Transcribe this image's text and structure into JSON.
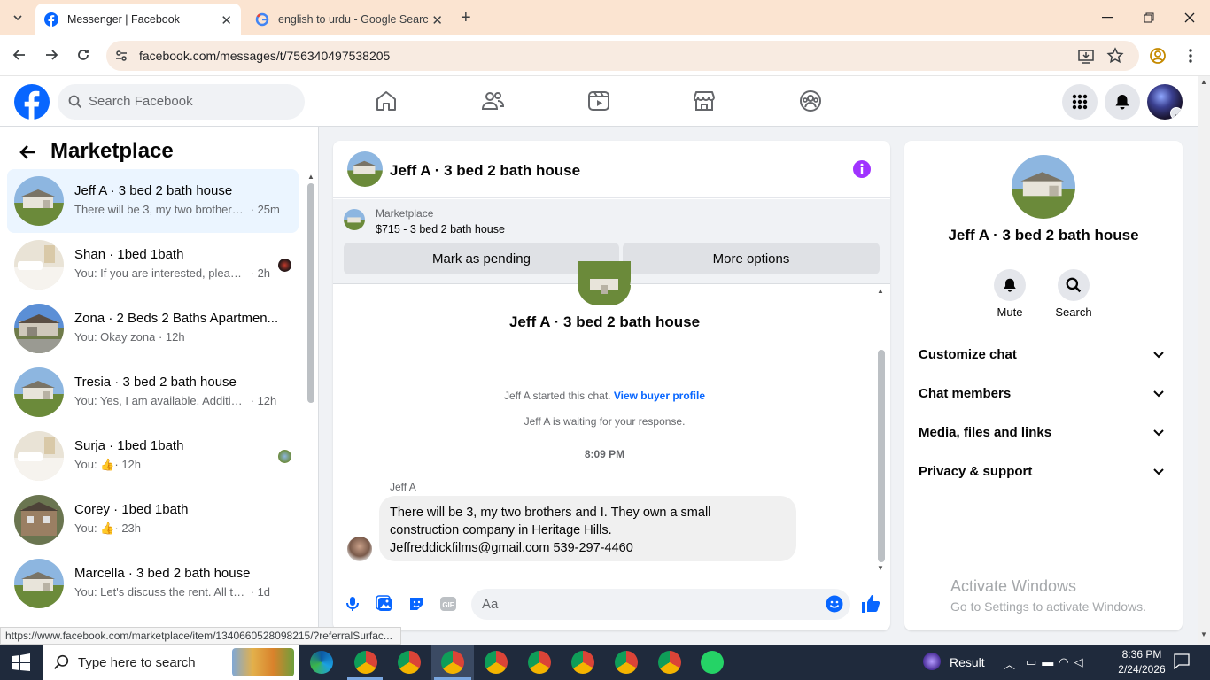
{
  "browser": {
    "tabs": [
      {
        "title": "Messenger | Facebook",
        "active": true
      },
      {
        "title": "english to urdu - Google Search",
        "active": false
      }
    ],
    "url": "facebook.com/messages/t/756340497538205"
  },
  "fb_header": {
    "search_placeholder": "Search Facebook",
    "nav_icons": [
      "home-icon",
      "friends-icon",
      "watch-icon",
      "marketplace-icon",
      "groups-icon"
    ]
  },
  "sidebar": {
    "title": "Marketplace",
    "conversations": [
      {
        "name": "Jeff A · 3 bed 2 bath house",
        "preview": "There will be 3, my two brothers ...",
        "time": "· 25m",
        "active": true
      },
      {
        "name": "Shan · 1bed 1bath",
        "preview": "You: If you are interested, please...",
        "time": "· 2h"
      },
      {
        "name": "Zona · 2 Beds 2 Baths Apartmen...",
        "preview": "You: Okay zona",
        "time": "· 12h"
      },
      {
        "name": "Tresia · 3 bed 2 bath house",
        "preview": "You: Yes, I am available. Additional...",
        "time": "· 12h"
      },
      {
        "name": "Surja · 1bed 1bath",
        "preview": "You:",
        "time": "· 12h"
      },
      {
        "name": "Corey · 1bed 1bath",
        "preview": "You:",
        "time": "· 23h"
      },
      {
        "name": "Marcella · 3 bed 2 bath house",
        "preview": "You: Let's discuss the rent. All the u...",
        "time": "· 1d"
      }
    ]
  },
  "chat": {
    "title": "Jeff A · 3 bed 2 bath house",
    "marketplace_label": "Marketplace",
    "listing": "$715 - 3 bed 2 bath house",
    "mark_pending": "Mark as pending",
    "more_options": "More options",
    "center_name": "Jeff A · 3 bed 2 bath house",
    "started_text": "Jeff A started this chat.",
    "view_profile": "View buyer profile",
    "waiting_text": "Jeff A is waiting for your response.",
    "timestamp": "8:09 PM",
    "sender": "Jeff A",
    "message_lines": [
      "There will be 3, my two brothers and I. They own a small",
      "construction company in Heritage Hills.",
      "Jeffreddickfilms@gmail.com 539-297-4460"
    ],
    "composer_placeholder": "Aa"
  },
  "info_panel": {
    "name": "Jeff A · 3 bed 2 bath house",
    "mute_label": "Mute",
    "search_label": "Search",
    "sections": [
      "Customize chat",
      "Chat members",
      "Media, files and links",
      "Privacy & support"
    ]
  },
  "watermark": {
    "line1": "Activate Windows",
    "line2": "Go to Settings to activate Windows."
  },
  "status_url": "https://www.facebook.com/marketplace/item/1340660528098215/?referralSurfac...",
  "taskbar": {
    "search_placeholder": "Type here to search",
    "result_label": "Result",
    "time": "8:36 PM",
    "date": "2/24/2026"
  },
  "colors": {
    "fb_blue": "#0866ff",
    "messenger_accent": "#a033ff",
    "tab_strip": "#fbe4d1"
  }
}
